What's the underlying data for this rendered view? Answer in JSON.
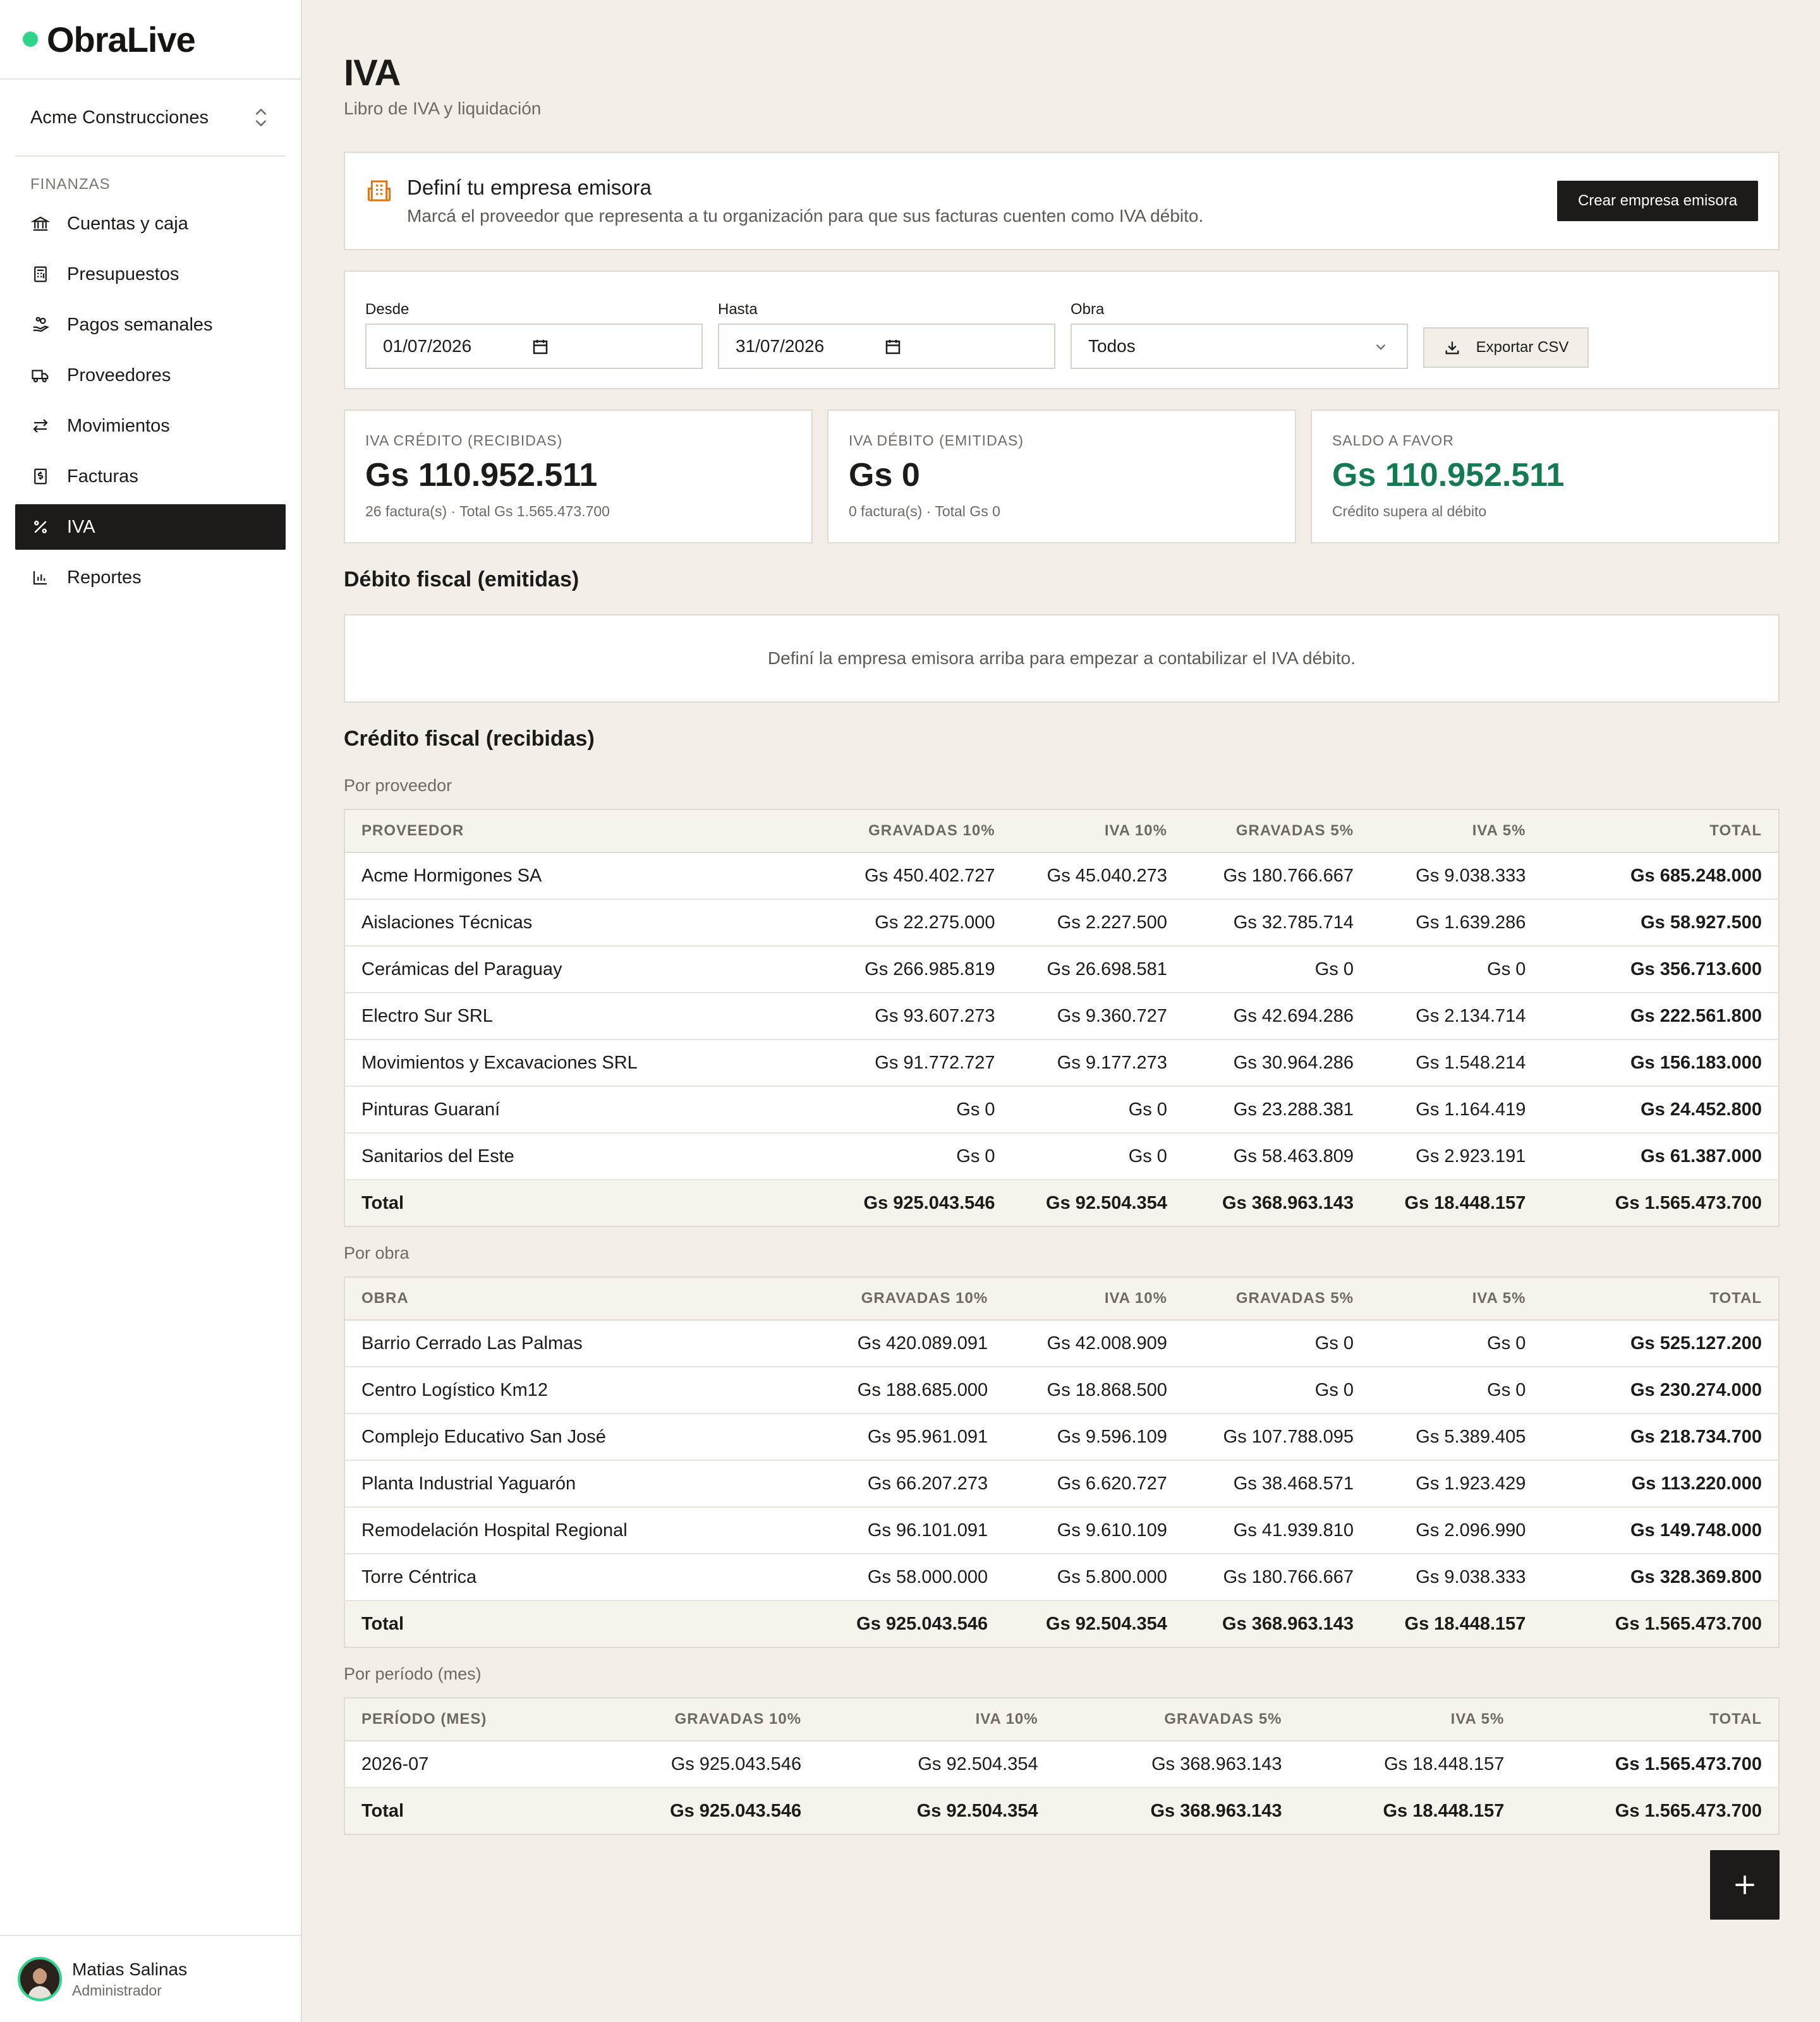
{
  "brand": {
    "name": "ObraLive"
  },
  "org": {
    "name": "Acme Construcciones"
  },
  "nav": {
    "section": "FINANZAS",
    "items": [
      {
        "label": "Cuentas y caja",
        "icon": "bank-icon"
      },
      {
        "label": "Presupuestos",
        "icon": "calculator-icon"
      },
      {
        "label": "Pagos semanales",
        "icon": "hand-coins-icon"
      },
      {
        "label": "Proveedores",
        "icon": "truck-icon"
      },
      {
        "label": "Movimientos",
        "icon": "arrows-left-right-icon"
      },
      {
        "label": "Facturas",
        "icon": "receipt-icon"
      },
      {
        "label": "IVA",
        "icon": "percent-icon",
        "active": true
      },
      {
        "label": "Reportes",
        "icon": "bar-chart-icon"
      }
    ]
  },
  "user": {
    "name": "Matias Salinas",
    "role": "Administrador"
  },
  "page": {
    "title": "IVA",
    "subtitle": "Libro de IVA y liquidación"
  },
  "banner": {
    "title": "Definí tu empresa emisora",
    "text": "Marcá el proveedor que representa a tu organización para que sus facturas cuenten como IVA débito.",
    "button": "Crear empresa emisora"
  },
  "filters": {
    "desde_label": "Desde",
    "desde_value": "01/07/2026",
    "hasta_label": "Hasta",
    "hasta_value": "31/07/2026",
    "obra_label": "Obra",
    "obra_value": "Todos",
    "export_label": "Exportar CSV"
  },
  "stats": [
    {
      "label": "IVA CRÉDITO (RECIBIDAS)",
      "value": "Gs 110.952.511",
      "sub": "26 factura(s) · Total Gs 1.565.473.700"
    },
    {
      "label": "IVA DÉBITO (EMITIDAS)",
      "value": "Gs 0",
      "sub": "0 factura(s) · Total Gs 0"
    },
    {
      "label": "SALDO A FAVOR",
      "value": "Gs 110.952.511",
      "sub": "Crédito supera al débito",
      "color": "#147a52"
    }
  ],
  "debito": {
    "title": "Débito fiscal (emitidas)",
    "empty": "Definí la empresa emisora arriba para empezar a contabilizar el IVA débito."
  },
  "credito": {
    "title": "Crédito fiscal (recibidas)",
    "por_proveedor": {
      "label": "Por proveedor",
      "headers": [
        "PROVEEDOR",
        "GRAVADAS 10%",
        "IVA 10%",
        "GRAVADAS 5%",
        "IVA 5%",
        "TOTAL"
      ],
      "rows": [
        [
          "Acme Hormigones SA",
          "Gs 450.402.727",
          "Gs 45.040.273",
          "Gs 180.766.667",
          "Gs 9.038.333",
          "Gs 685.248.000"
        ],
        [
          "Aislaciones Técnicas",
          "Gs 22.275.000",
          "Gs 2.227.500",
          "Gs 32.785.714",
          "Gs 1.639.286",
          "Gs 58.927.500"
        ],
        [
          "Cerámicas del Paraguay",
          "Gs 266.985.819",
          "Gs 26.698.581",
          "Gs 0",
          "Gs 0",
          "Gs 356.713.600"
        ],
        [
          "Electro Sur SRL",
          "Gs 93.607.273",
          "Gs 9.360.727",
          "Gs 42.694.286",
          "Gs 2.134.714",
          "Gs 222.561.800"
        ],
        [
          "Movimientos y Excavaciones SRL",
          "Gs 91.772.727",
          "Gs 9.177.273",
          "Gs 30.964.286",
          "Gs 1.548.214",
          "Gs 156.183.000"
        ],
        [
          "Pinturas Guaraní",
          "Gs 0",
          "Gs 0",
          "Gs 23.288.381",
          "Gs 1.164.419",
          "Gs 24.452.800"
        ],
        [
          "Sanitarios del Este",
          "Gs 0",
          "Gs 0",
          "Gs 58.463.809",
          "Gs 2.923.191",
          "Gs 61.387.000"
        ]
      ],
      "total": [
        "Total",
        "Gs 925.043.546",
        "Gs 92.504.354",
        "Gs 368.963.143",
        "Gs 18.448.157",
        "Gs 1.565.473.700"
      ]
    },
    "por_obra": {
      "label": "Por obra",
      "headers": [
        "OBRA",
        "GRAVADAS 10%",
        "IVA 10%",
        "GRAVADAS 5%",
        "IVA 5%",
        "TOTAL"
      ],
      "rows": [
        [
          "Barrio Cerrado Las Palmas",
          "Gs 420.089.091",
          "Gs 42.008.909",
          "Gs 0",
          "Gs 0",
          "Gs 525.127.200"
        ],
        [
          "Centro Logístico Km12",
          "Gs 188.685.000",
          "Gs 18.868.500",
          "Gs 0",
          "Gs 0",
          "Gs 230.274.000"
        ],
        [
          "Complejo Educativo San José",
          "Gs 95.961.091",
          "Gs 9.596.109",
          "Gs 107.788.095",
          "Gs 5.389.405",
          "Gs 218.734.700"
        ],
        [
          "Planta Industrial Yaguarón",
          "Gs 66.207.273",
          "Gs 6.620.727",
          "Gs 38.468.571",
          "Gs 1.923.429",
          "Gs 113.220.000"
        ],
        [
          "Remodelación Hospital Regional",
          "Gs 96.101.091",
          "Gs 9.610.109",
          "Gs 41.939.810",
          "Gs 2.096.990",
          "Gs 149.748.000"
        ],
        [
          "Torre Céntrica",
          "Gs 58.000.000",
          "Gs 5.800.000",
          "Gs 180.766.667",
          "Gs 9.038.333",
          "Gs 328.369.800"
        ]
      ],
      "total": [
        "Total",
        "Gs 925.043.546",
        "Gs 92.504.354",
        "Gs 368.963.143",
        "Gs 18.448.157",
        "Gs 1.565.473.700"
      ]
    },
    "por_periodo": {
      "label": "Por período (mes)",
      "headers": [
        "PERÍODO (MES)",
        "GRAVADAS 10%",
        "IVA 10%",
        "GRAVADAS 5%",
        "IVA 5%",
        "TOTAL"
      ],
      "rows": [
        [
          "2026-07",
          "Gs 925.043.546",
          "Gs 92.504.354",
          "Gs 368.963.143",
          "Gs 18.448.157",
          "Gs 1.565.473.700"
        ]
      ],
      "total": [
        "Total",
        "Gs 925.043.546",
        "Gs 92.504.354",
        "Gs 368.963.143",
        "Gs 18.448.157",
        "Gs 1.565.473.700"
      ]
    }
  },
  "colors": {
    "accent_green": "#147a52",
    "brand_dot": "#2fd38a",
    "dark": "#1c1b19",
    "background": "#f3efe8"
  }
}
